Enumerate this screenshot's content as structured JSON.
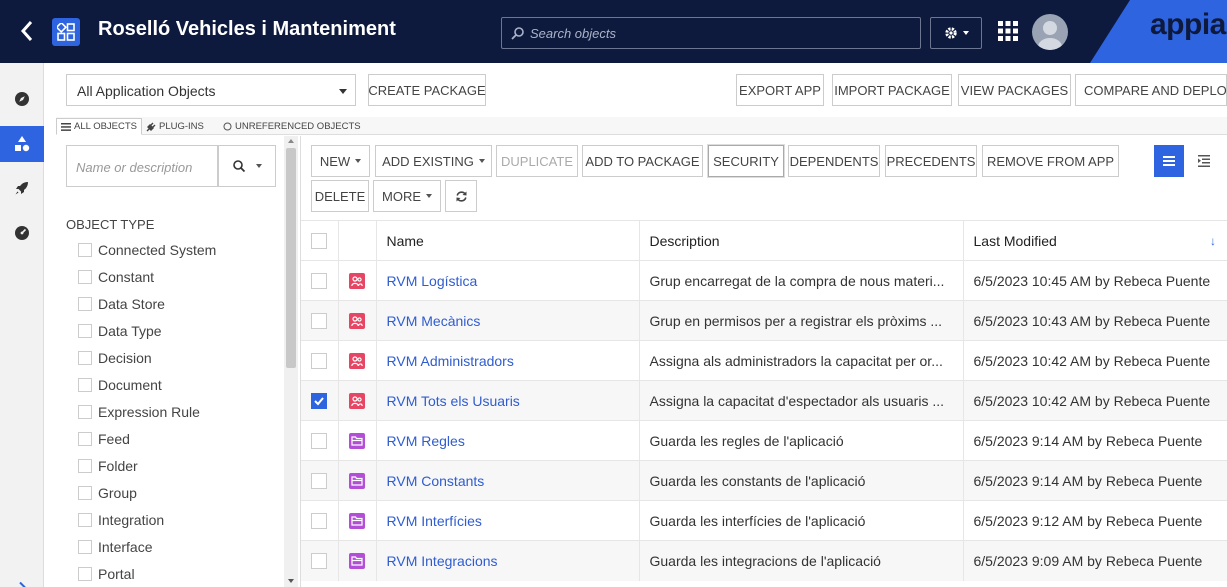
{
  "header": {
    "app_title": "Roselló Vehicles i Manteniment",
    "search_placeholder": "Search objects",
    "brand": "appian",
    "colors": {
      "bar": "#0e1a3d",
      "accent": "#2f64e0",
      "brand_bg": "#2f64e0"
    }
  },
  "rail": {
    "items": [
      {
        "icon": "compass-icon",
        "active": false
      },
      {
        "icon": "objects-icon",
        "active": true
      },
      {
        "icon": "rocket-icon",
        "active": false
      },
      {
        "icon": "dashboard-icon",
        "active": false
      }
    ],
    "expand_icon": "chevron-right-icon"
  },
  "topbar": {
    "object_filter": "All Application Objects",
    "create_package": "CREATE PACKAGE",
    "export_app": "EXPORT APP",
    "import_package": "IMPORT PACKAGE",
    "view_packages": "VIEW PACKAGES",
    "compare_deploy": "COMPARE AND DEPLOY"
  },
  "tabs": {
    "all_objects": "ALL OBJECTS",
    "plugins": "PLUG-INS",
    "unreferenced": "UNREFERENCED OBJECTS"
  },
  "filters": {
    "search_placeholder": "Name or description",
    "heading": "OBJECT TYPE",
    "types": [
      "Connected System",
      "Constant",
      "Data Store",
      "Data Type",
      "Decision",
      "Document",
      "Expression Rule",
      "Feed",
      "Folder",
      "Group",
      "Integration",
      "Interface",
      "Portal"
    ]
  },
  "actions": {
    "new": "NEW",
    "add_existing": "ADD EXISTING",
    "duplicate": "DUPLICATE",
    "add_to_package": "ADD TO PACKAGE",
    "security": "SECURITY",
    "dependents": "DEPENDENTS",
    "precedents": "PRECEDENTS",
    "remove_from_app": "REMOVE FROM APP",
    "delete": "DELETE",
    "more": "MORE"
  },
  "table": {
    "columns": {
      "name": "Name",
      "description": "Description",
      "last_modified": "Last Modified"
    },
    "rows": [
      {
        "type": "group",
        "checked": false,
        "name": "RVM Logística",
        "description": "Grup encarregat de la compra de nous materi...",
        "modified": "6/5/2023 10:45 AM by Rebeca Puente"
      },
      {
        "type": "group",
        "checked": false,
        "name": "RVM Mecànics",
        "description": "Grup en permisos per a registrar els pròxims ...",
        "modified": "6/5/2023 10:43 AM by Rebeca Puente"
      },
      {
        "type": "group",
        "checked": false,
        "name": "RVM Administradors",
        "description": "Assigna als administradors la capacitat per or...",
        "modified": "6/5/2023 10:42 AM by Rebeca Puente"
      },
      {
        "type": "group",
        "checked": true,
        "name": "RVM Tots els Usuaris",
        "description": "Assigna la capacitat d'espectador als usuaris ...",
        "modified": "6/5/2023 10:42 AM by Rebeca Puente"
      },
      {
        "type": "folder",
        "checked": false,
        "name": "RVM Regles",
        "description": "Guarda les regles de l'aplicació",
        "modified": "6/5/2023 9:14 AM by Rebeca Puente"
      },
      {
        "type": "folder",
        "checked": false,
        "name": "RVM Constants",
        "description": "Guarda les constants de l'aplicació",
        "modified": "6/5/2023 9:14 AM by Rebeca Puente"
      },
      {
        "type": "folder",
        "checked": false,
        "name": "RVM Interfícies",
        "description": "Guarda les interfícies de l'aplicació",
        "modified": "6/5/2023 9:12 AM by Rebeca Puente"
      },
      {
        "type": "folder",
        "checked": false,
        "name": "RVM Integracions",
        "description": "Guarda les integracions de l'aplicació",
        "modified": "6/5/2023 9:09 AM by Rebeca Puente"
      }
    ]
  }
}
